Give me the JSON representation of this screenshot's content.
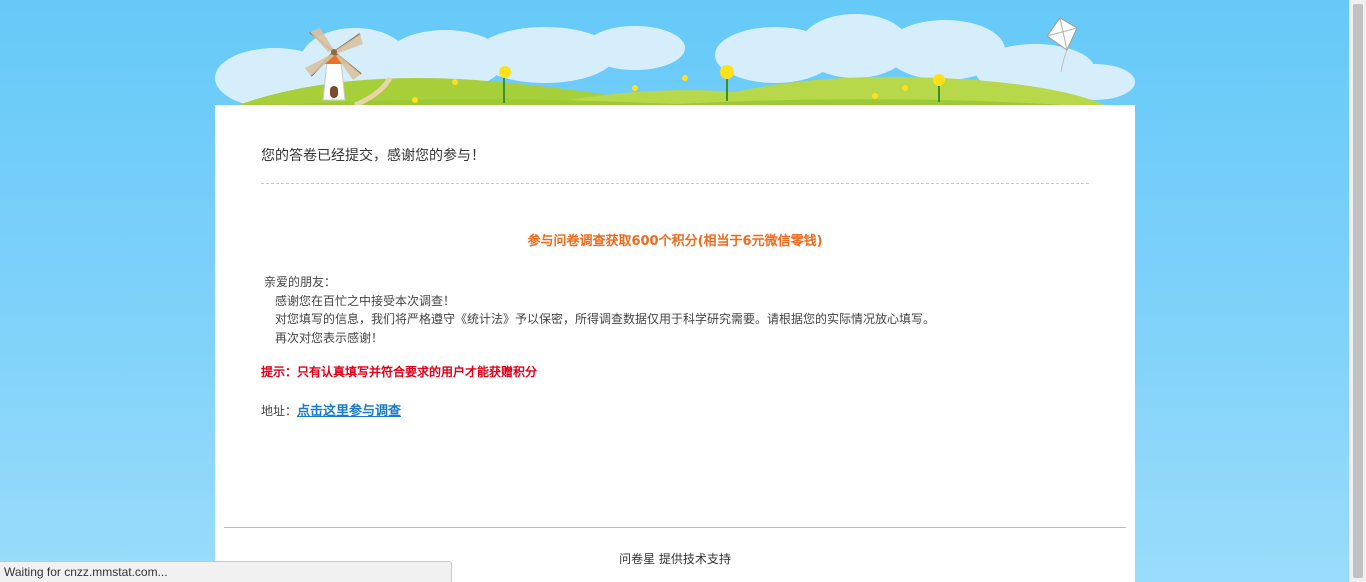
{
  "page": {
    "submitted_message": "您的答卷已经提交，感谢您的参与！",
    "reward_title": "参与问卷调查获取600个积分(相当于6元微信零钱)",
    "letter": {
      "greeting": "亲爱的朋友：",
      "line1": "感谢您在百忙之中接受本次调查！",
      "line2": "对您填写的信息，我们将严格遵守《统计法》予以保密，所得调查数据仅用于科学研究需要。请根据您的实际情况放心填写。",
      "line3": "再次对您表示感谢！"
    },
    "tip": "提示：只有认真填写并符合要求的用户才能获赠积分",
    "address_label": "地址：",
    "address_link": "点击这里参与调查",
    "footer": "问卷星 提供技术支持"
  },
  "browser": {
    "status_text": "Waiting for cnzz.mmstat.com..."
  },
  "colors": {
    "sky": "#66c9f8",
    "accent_orange": "#ef6a1d",
    "tip_red": "#e2001a",
    "link_blue": "#1a7bc9",
    "grass": "#a6cf3a"
  }
}
